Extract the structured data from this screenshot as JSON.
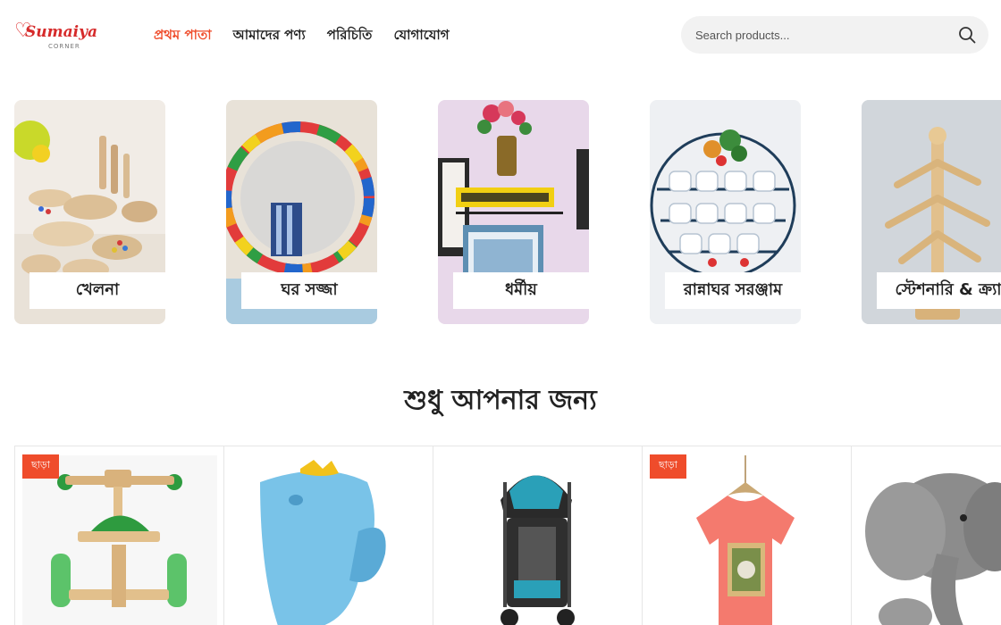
{
  "brand": {
    "name": "Sumaiya",
    "tagline": "CORNER"
  },
  "nav": [
    {
      "label": "প্রথম পাতা",
      "active": true
    },
    {
      "label": "আমাদের পণ্য",
      "active": false
    },
    {
      "label": "পরিচিতি",
      "active": false
    },
    {
      "label": "যোগাযোগ",
      "active": false
    }
  ],
  "search": {
    "placeholder": "Search products..."
  },
  "categories": [
    {
      "label": "খেলনা",
      "image": "wooden-toys-image"
    },
    {
      "label": "ঘর সজ্জা",
      "image": "colorful-mirror-image"
    },
    {
      "label": "ধর্মীয়",
      "image": "islamic-wall-decor-image"
    },
    {
      "label": "রান্নাঘর সরঞ্জাম",
      "image": "mug-rack-image"
    },
    {
      "label": "স্টেশনারি & ক্র্যা",
      "image": "wooden-mug-tree-image"
    }
  ],
  "section_title": "শুধু আপনার জন্য",
  "products": [
    {
      "badge": "ছাড়া",
      "image": "wooden-balance-bike-image"
    },
    {
      "badge": "",
      "image": "blue-whale-bath-rinser-image"
    },
    {
      "badge": "",
      "image": "baby-stroller-image"
    },
    {
      "badge": "ছাড়া",
      "image": "coral-tshirt-image"
    },
    {
      "badge": "",
      "image": "grey-plush-elephant-image"
    }
  ],
  "colors": {
    "accent": "#ef4c2b",
    "brand": "#d62a2a",
    "search_bg": "#f2f2f2"
  }
}
